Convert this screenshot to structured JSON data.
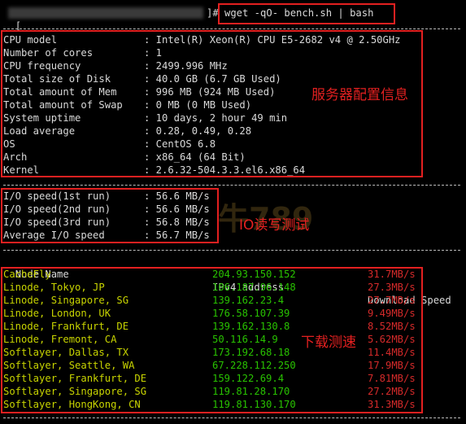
{
  "prompt": {
    "bracket_open": "[",
    "end": "]#",
    "command": "wget -qO- bench.sh | bash"
  },
  "sysinfo": [
    {
      "label": "CPU model",
      "value": "Intel(R) Xeon(R) CPU E5-2682 v4 @ 2.50GHz"
    },
    {
      "label": "Number of cores",
      "value": "1"
    },
    {
      "label": "CPU frequency",
      "value": "2499.996 MHz"
    },
    {
      "label": "Total size of Disk",
      "value": "40.0 GB (6.7 GB Used)"
    },
    {
      "label": "Total amount of Mem",
      "value": "996 MB (924 MB Used)"
    },
    {
      "label": "Total amount of Swap",
      "value": "0 MB (0 MB Used)"
    },
    {
      "label": "System uptime",
      "value": "10 days, 2 hour 49 min"
    },
    {
      "label": "Load average",
      "value": "0.28, 0.49, 0.28"
    },
    {
      "label": "OS",
      "value": "CentOS 6.8"
    },
    {
      "label": "Arch",
      "value": "x86_64 (64 Bit)"
    },
    {
      "label": "Kernel",
      "value": "2.6.32-504.3.3.el6.x86_64"
    }
  ],
  "io": [
    {
      "label": "I/O speed(1st run)",
      "value": "56.6 MB/s"
    },
    {
      "label": "I/O speed(2nd run)",
      "value": "56.6 MB/s"
    },
    {
      "label": "I/O speed(3rd run)",
      "value": "56.8 MB/s"
    },
    {
      "label": "Average I/O speed",
      "value": "56.7 MB/s"
    }
  ],
  "net_header": {
    "node": "Node Name",
    "ip": "IPv4 address",
    "speed": "Download Speed"
  },
  "net": [
    {
      "node": "CacheFly",
      "ip": "204.93.150.152",
      "speed": "31.7MB/s"
    },
    {
      "node": "Linode, Tokyo, JP",
      "ip": "106.187.96.148",
      "speed": "27.3MB/s"
    },
    {
      "node": "Linode, Singapore, SG",
      "ip": "139.162.23.4",
      "speed": "27.7MB/s"
    },
    {
      "node": "Linode, London, UK",
      "ip": "176.58.107.39",
      "speed": "9.49MB/s"
    },
    {
      "node": "Linode, Frankfurt, DE",
      "ip": "139.162.130.8",
      "speed": "8.52MB/s"
    },
    {
      "node": "Linode, Fremont, CA",
      "ip": "50.116.14.9",
      "speed": "5.62MB/s"
    },
    {
      "node": "Softlayer, Dallas, TX",
      "ip": "173.192.68.18",
      "speed": "11.4MB/s"
    },
    {
      "node": "Softlayer, Seattle, WA",
      "ip": "67.228.112.250",
      "speed": "17.9MB/s"
    },
    {
      "node": "Softlayer, Frankfurt, DE",
      "ip": "159.122.69.4",
      "speed": "7.81MB/s"
    },
    {
      "node": "Softlayer, Singapore, SG",
      "ip": "119.81.28.170",
      "speed": "27.2MB/s"
    },
    {
      "node": "Softlayer, HongKong, CN",
      "ip": "119.81.130.170",
      "speed": "31.3MB/s"
    }
  ],
  "annotations": {
    "config": "服务器配置信息",
    "io": "IO读写测试",
    "net": "下载测速"
  },
  "watermark": "牛789",
  "colors": {
    "annotation": "#e32020",
    "ip": "#28c200",
    "speed": "#d42a2a",
    "value": "#c8d400"
  }
}
